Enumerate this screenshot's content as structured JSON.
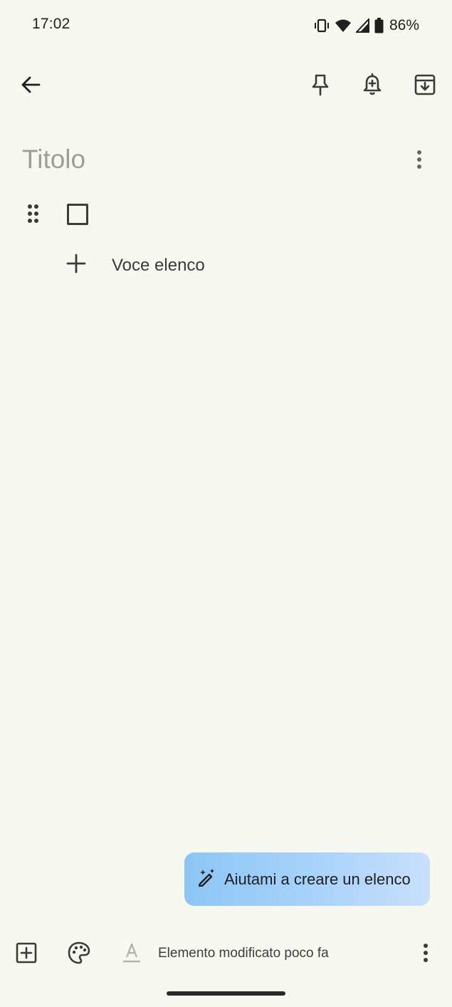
{
  "status_bar": {
    "time": "17:02",
    "battery_percent": "86%",
    "icons": [
      "vibrate-icon",
      "wifi-icon",
      "signal-icon",
      "battery-icon"
    ]
  },
  "toolbar": {
    "icons": [
      "back-arrow-icon",
      "pin-icon",
      "reminder-bell-icon",
      "archive-icon"
    ]
  },
  "note": {
    "title_placeholder": "Titolo",
    "add_item_label": "Voce elenco"
  },
  "ai_button": {
    "label": "Aiutami a creare un elenco",
    "icon": "magic-pen-icon"
  },
  "bottom_bar": {
    "status_text": "Elemento modificato poco fa",
    "icons": [
      "add-box-icon",
      "palette-icon",
      "text-format-icon",
      "more-vert-icon"
    ]
  },
  "colors": {
    "background": "#f7f8f0",
    "ai_gradient_start": "#8cc6f6",
    "ai_gradient_end": "#c9e0fc",
    "placeholder": "#9e9e98"
  }
}
